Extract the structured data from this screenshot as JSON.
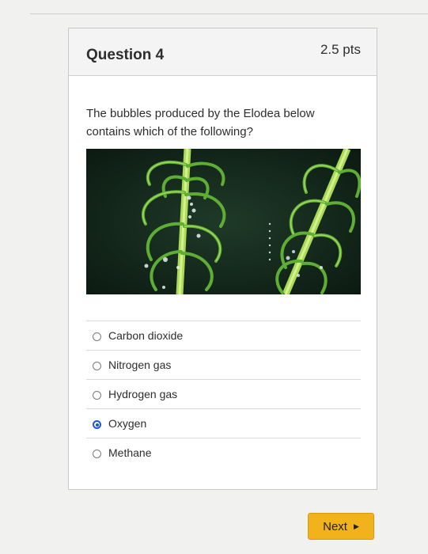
{
  "question": {
    "title": "Question 4",
    "points": "2.5 pts",
    "text": "The bubbles produced by the Elodea below contains which of the following?"
  },
  "answers": [
    {
      "label": "Carbon dioxide",
      "selected": false
    },
    {
      "label": "Nitrogen gas",
      "selected": false
    },
    {
      "label": "Hydrogen gas",
      "selected": false
    },
    {
      "label": "Oxygen",
      "selected": true
    },
    {
      "label": "Methane",
      "selected": false
    }
  ],
  "navigation": {
    "next_label": "Next",
    "next_icon": "triangle-right-icon"
  },
  "colors": {
    "accent": "#1a56d6",
    "next_button": "#f2b21b",
    "plant_green": "#7fc943"
  }
}
